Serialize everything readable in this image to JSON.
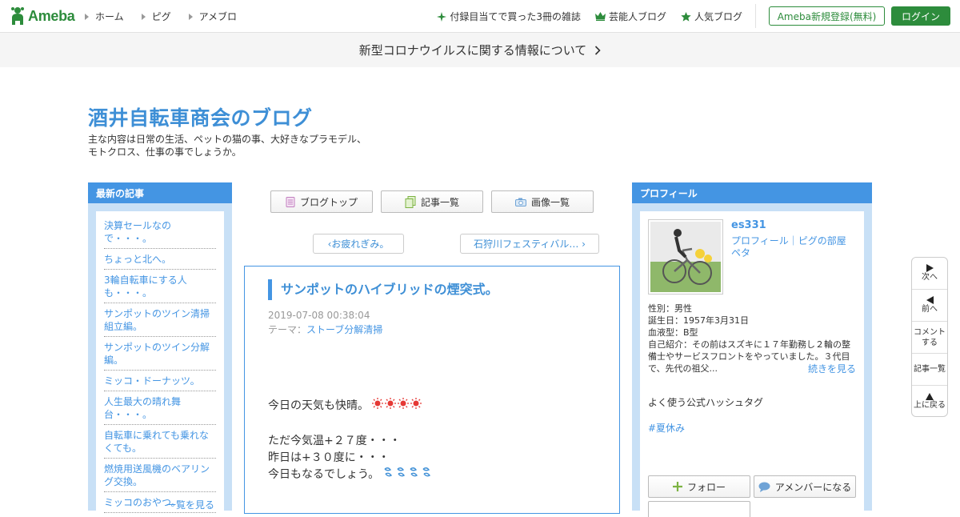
{
  "header": {
    "logo_text": "Ameba",
    "nav": [
      "ホーム",
      "ピグ",
      "アメブロ"
    ],
    "right_links": [
      {
        "icon": "sparkle-icon",
        "label": "付録目当てで買った3冊の雑誌"
      },
      {
        "icon": "crown-icon",
        "label": "芸能人ブログ"
      },
      {
        "icon": "star-icon",
        "label": "人気ブログ"
      }
    ],
    "register_label": "Ameba新規登録(無料)",
    "login_label": "ログイン"
  },
  "notice": {
    "text": "新型コロナウイルスに関する情報について"
  },
  "blog": {
    "title": "酒井自転車商会のブログ",
    "desc_line1": "主な内容は日常の生活、ペットの猫の事、大好きなプラモデル、",
    "desc_line2": "モトクロス、仕事の事でしょうか。"
  },
  "left_sidebar": {
    "heading": "最新の記事",
    "items": [
      "決算セールなので・・・。",
      "ちょっと北へ。",
      "3輪自転車にする人も・・・。",
      "サンポットのツイン清掃組立編。",
      "サンポットのツイン分解編。",
      "ミッコ・ドーナッツ。",
      "人生最大の晴れ舞台・・・。",
      "自転車に乗れても乗れなくても。",
      "燃焼用送風機のベアリング交換。",
      "ミッコのおやつ。"
    ],
    "more_label": "一覧を見る"
  },
  "tabs": {
    "blog_top": "ブログトップ",
    "articles": "記事一覧",
    "images": "画像一覧"
  },
  "pager": {
    "prev": "‹お疲れぎみ。",
    "next": "石狩川フェスティバル… ›"
  },
  "article": {
    "title": "サンポットのハイブリッドの煙突式。",
    "date": "2019-07-08 00:38:04",
    "theme_prefix": "テーマ：",
    "theme_link": "ストーブ分解清掃",
    "line1": "今日の天気も快晴。",
    "line2": "ただ今気温+２７度・・・",
    "line3": "昨日は+３０度に・・・",
    "line4": "今日もなるでしょう。"
  },
  "profile": {
    "heading": "プロフィール",
    "name": "es331",
    "links": "プロフィール｜ピグの部屋 ペタ",
    "gender": "性別：男性",
    "birthday": "誕生日：1957年3月31日",
    "blood": "血液型：B型",
    "intro": "自己紹介：その前はスズキに１７年勤務し２輪の整備士やサービスフロントをやっていました。３代目で、先代の祖父...",
    "read_more": "続きを見る",
    "hashtag_heading": "よく使う公式ハッシュタグ",
    "hashtag": "#夏休み",
    "follow_label": "フォロー",
    "amember_label": "アメンバーになる"
  },
  "float_nav": {
    "next": "次へ",
    "prev": "前へ",
    "comment": "コメントする",
    "list": "記事一覧",
    "top": "上に戻る"
  },
  "colors": {
    "accent": "#4495e3",
    "brand_green": "#2d8c3c",
    "sidebar_bg": "#c8e0f6"
  }
}
